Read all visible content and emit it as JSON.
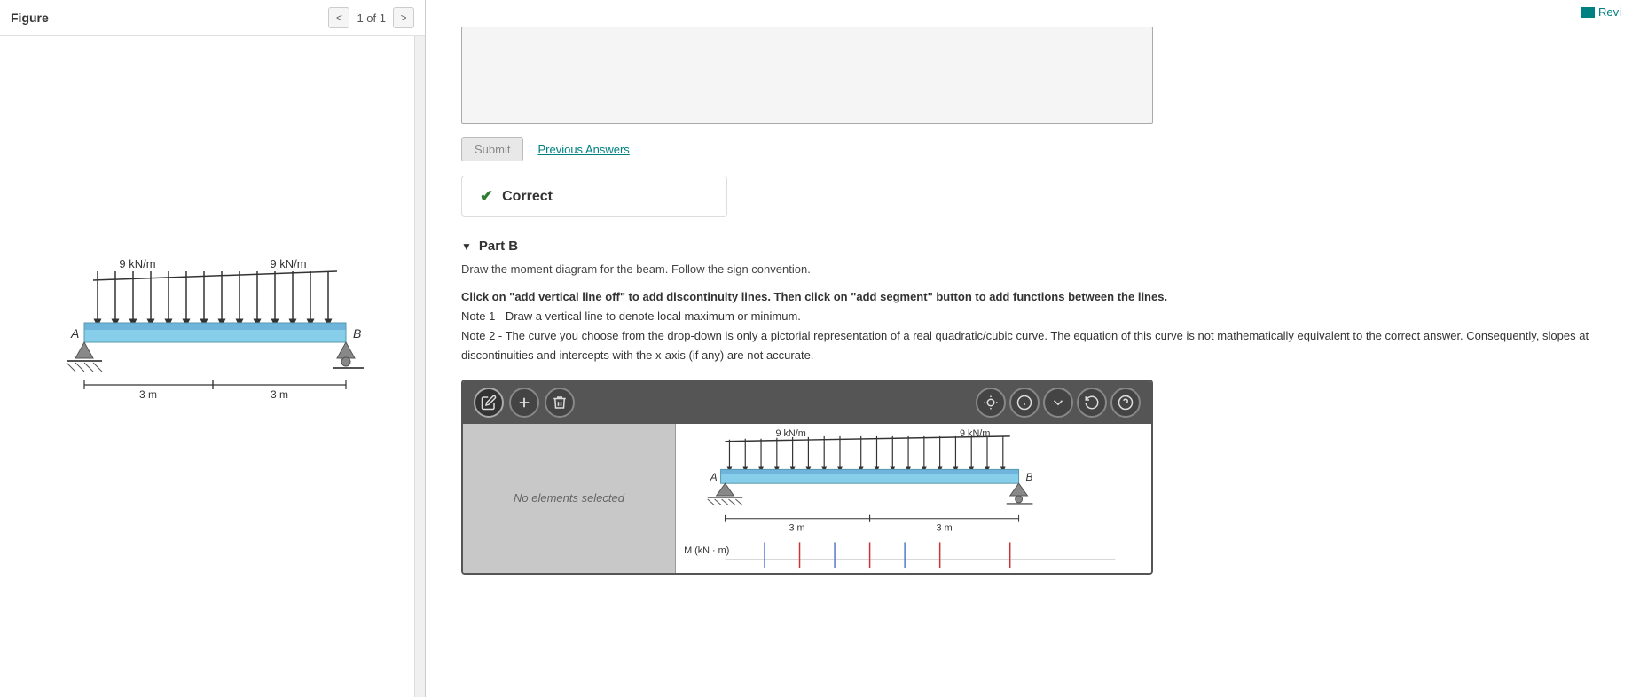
{
  "topBar": {
    "reviewLabel": "Revi"
  },
  "leftPanel": {
    "figureTitle": "Figure",
    "pageLabel": "1 of 1",
    "prevNavLabel": "<",
    "nextNavLabel": ">",
    "beamDiagram": {
      "leftLoad": "9 kN/m",
      "rightLoad": "9 kN/m",
      "labelA": "A",
      "labelB": "B",
      "leftSpan": "3 m",
      "rightSpan": "3 m"
    }
  },
  "rightPanel": {
    "submitLabel": "Submit",
    "previousAnswersLabel": "Previous Answers",
    "correctText": "Correct",
    "partBLabel": "Part B",
    "instructions": {
      "main": "Draw the moment diagram for the beam. Follow the sign convention.",
      "note1": "Click on \"add vertical line off\" to add discontinuity lines. Then click on \"add segment\" button to add functions between the lines.",
      "note2": "Note 1 - Draw a vertical line to denote local maximum or minimum.",
      "note3": "Note 2 - The curve you choose from the drop-down is only a pictorial representation of a real quadratic/cubic curve. The equation of this curve is not mathematically equivalent to the correct answer. Consequently, slopes at discontinuities and intercepts with the x-axis (if any) are not accurate."
    },
    "diagram": {
      "noElementsText": "No elements selected",
      "beamPreview": {
        "leftLoad": "9 kN/m",
        "rightLoad": "9 kN/m",
        "labelA": "A",
        "labelB": "B",
        "leftSpan": "3 m",
        "rightSpan": "3 m",
        "momentLabel": "M (kN · m)"
      }
    }
  }
}
